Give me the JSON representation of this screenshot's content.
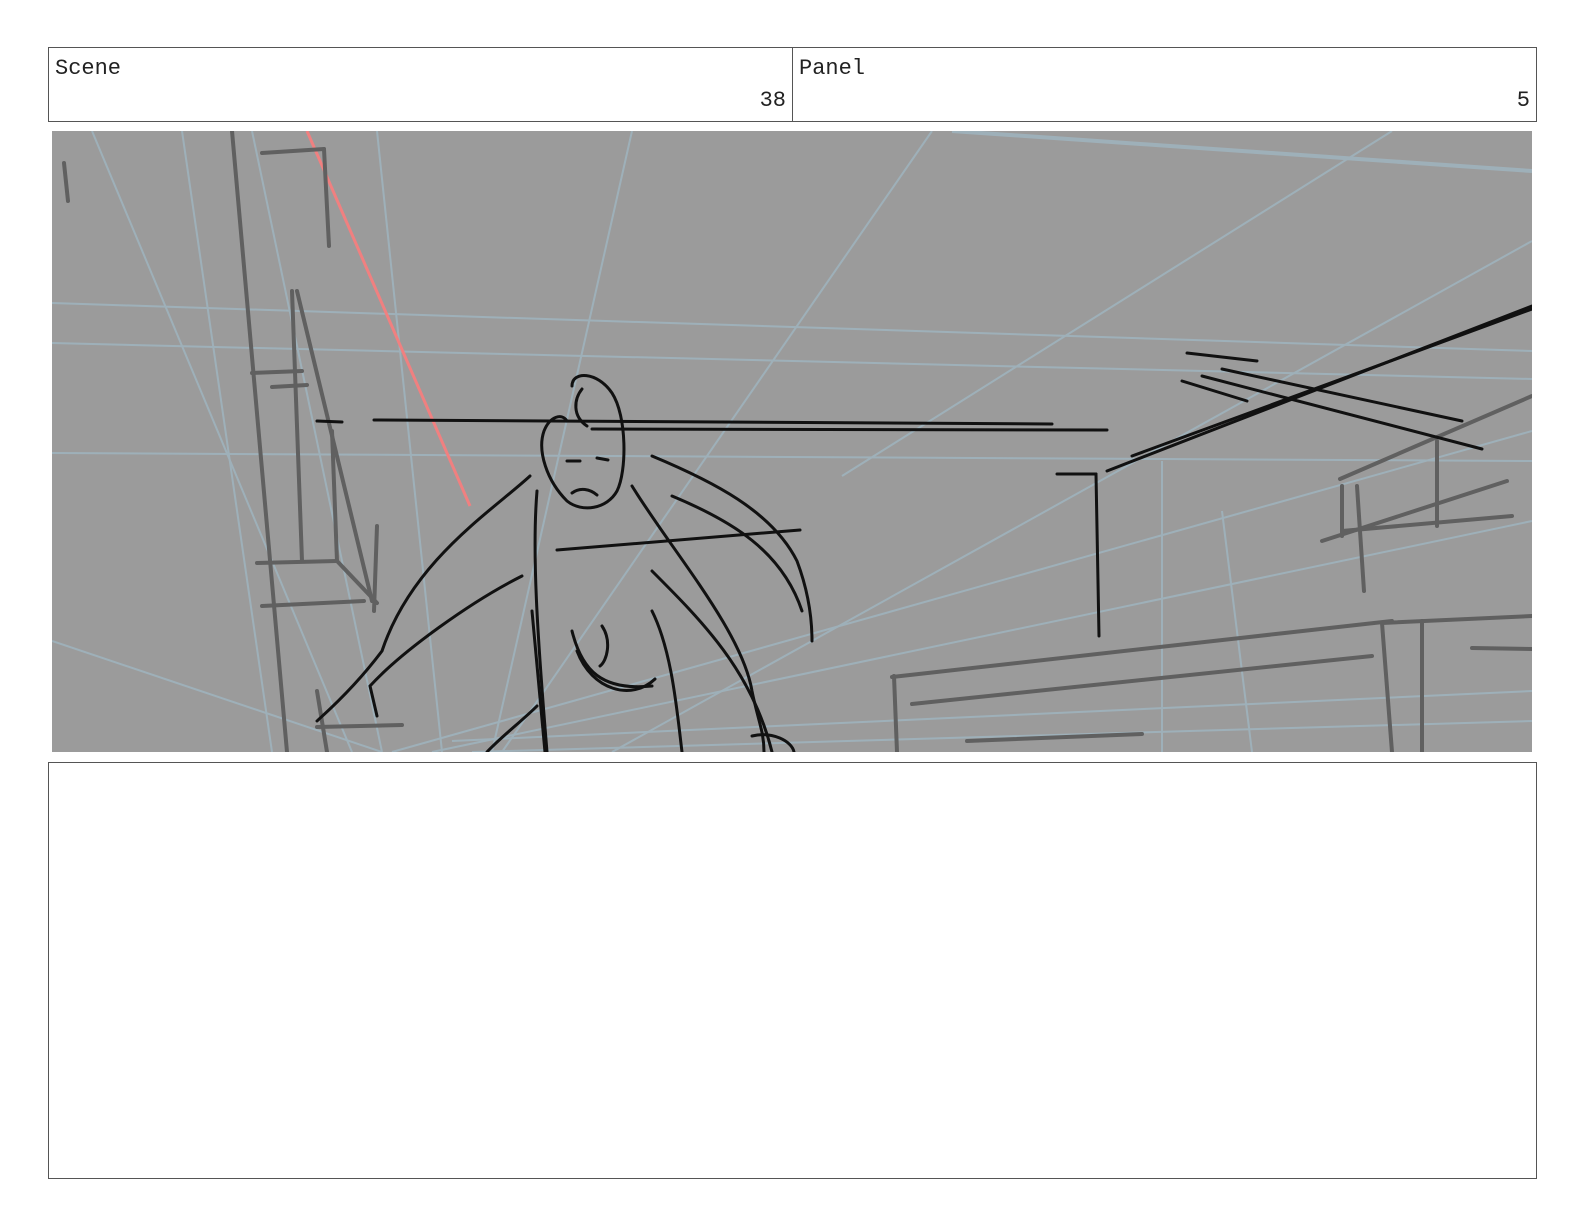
{
  "header": {
    "scene_label": "Scene",
    "scene_value": "38",
    "panel_label": "Panel",
    "panel_value": "5"
  },
  "notes": {
    "text": ""
  },
  "colors": {
    "frame_bg": "#9b9b9b",
    "perspective_lines": "#9fb3bd",
    "sketch_dark": "#111111",
    "sketch_gray": "#606060",
    "accent_red": "#f08080"
  }
}
